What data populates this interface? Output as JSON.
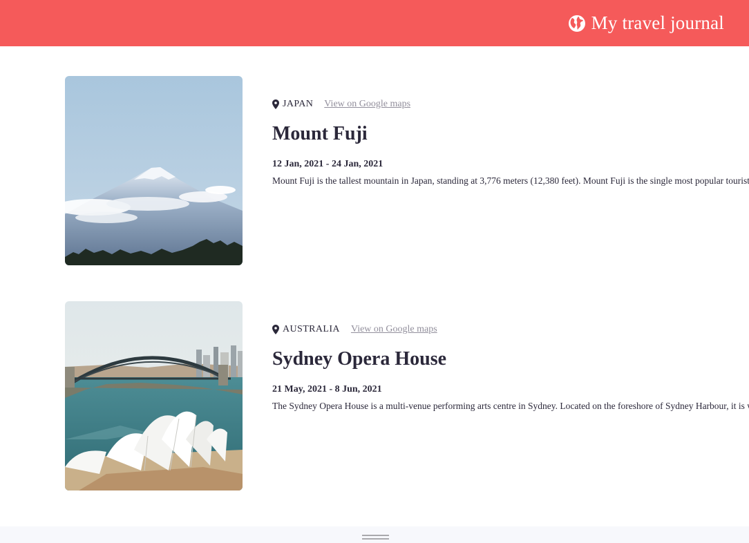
{
  "header": {
    "title": "My travel journal",
    "icon": "globe-icon",
    "background_color": "#f55a5a"
  },
  "entries": [
    {
      "country": "JAPAN",
      "maps_link": "View on Google maps",
      "title": "Mount Fuji",
      "dates": "12 Jan, 2021 - 24 Jan, 2021",
      "description": "Mount Fuji is the tallest mountain in Japan, standing at 3,776 meters (12,380 feet). Mount Fuji is the single most popular tourist site in Japan, for both Japanese and foreign tourists.",
      "image": "mount-fuji-photo"
    },
    {
      "country": "AUSTRALIA",
      "maps_link": "View on Google maps",
      "title": "Sydney Opera House",
      "dates": "21 May, 2021 - 8 Jun, 2021",
      "description": "The Sydney Opera House is a multi-venue performing arts centre in Sydney. Located on the foreshore of Sydney Harbour, it is widely regarded as one of the world's most famous and distinctive buildings.",
      "image": "sydney-opera-house-photo"
    }
  ]
}
